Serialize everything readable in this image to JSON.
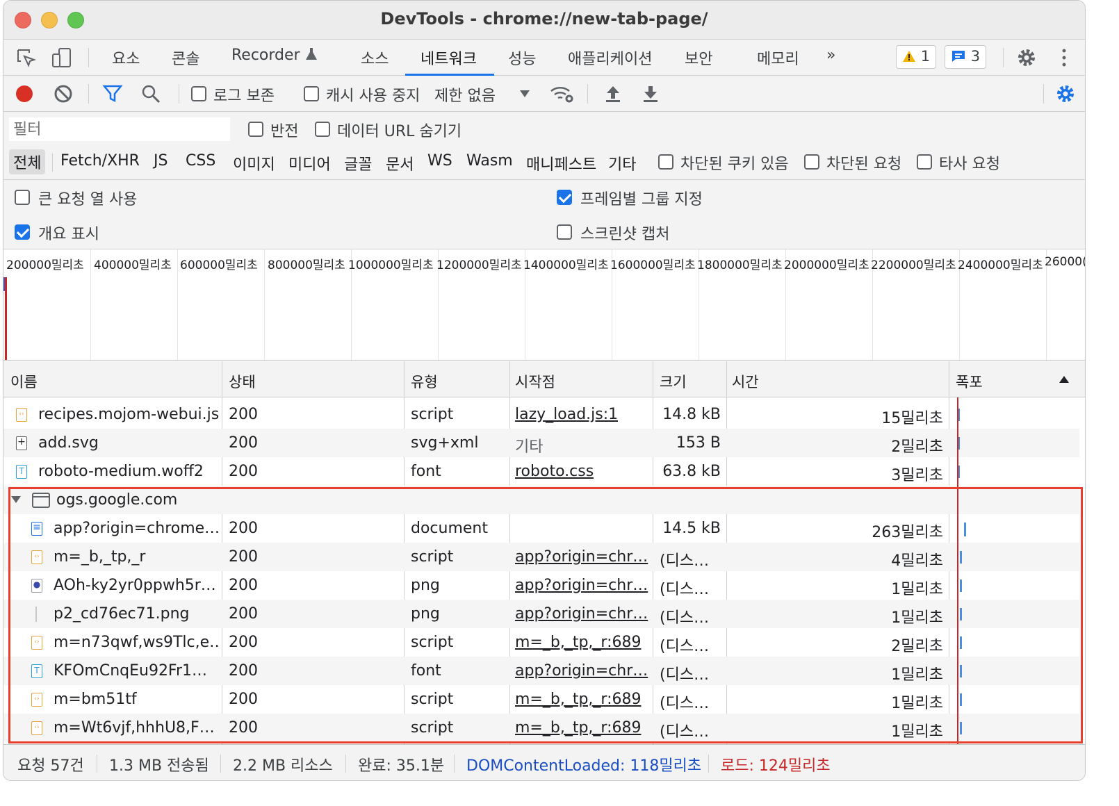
{
  "window": {
    "title": "DevTools - chrome://new-tab-page/"
  },
  "panel_tabs": [
    {
      "label": "요소"
    },
    {
      "label": "콘솔"
    },
    {
      "label": "Recorder"
    },
    {
      "label": "소스"
    },
    {
      "label": "네트워크",
      "active": true
    },
    {
      "label": "성능"
    },
    {
      "label": "애플리케이션"
    },
    {
      "label": "보안"
    },
    {
      "label": "메모리"
    }
  ],
  "panel_more": "»",
  "badges": {
    "warnings": "1",
    "messages": "3"
  },
  "toolbar": {
    "preserve_log": "로그 보존",
    "disable_cache": "캐시 사용 중지",
    "throttling": "제한 없음"
  },
  "filter": {
    "placeholder": "필터",
    "invert": "반전",
    "hide_data_urls": "데이터 URL 숨기기",
    "types": [
      "전체",
      "Fetch/XHR",
      "JS",
      "CSS",
      "이미지",
      "미디어",
      "글꼴",
      "문서",
      "WS",
      "Wasm",
      "매니페스트",
      "기타"
    ],
    "blocked_cookies": "차단된 쿠키 있음",
    "blocked_requests": "차단된 요청",
    "third_party": "타사 요청"
  },
  "settings": {
    "big_rows": "큰 요청 열 사용",
    "group_by_frame": "프레임별 그룹 지정",
    "show_overview": "개요 표시",
    "screenshots": "스크린샷 캡처"
  },
  "overview_ticks": [
    "200000밀리초",
    "400000밀리초",
    "600000밀리초",
    "800000밀리초",
    "1000000밀리초",
    "1200000밀리초",
    "1400000밀리초",
    "1600000밀리초",
    "1800000밀리초",
    "2000000밀리초",
    "2200000밀리초",
    "2400000밀리초",
    "26000("
  ],
  "columns": {
    "name": "이름",
    "status": "상태",
    "type": "유형",
    "initiator": "시작점",
    "size": "크기",
    "time": "시간",
    "waterfall": "폭포"
  },
  "rows": [
    {
      "name": "recipes.mojom-webui.js",
      "status": "200",
      "type": "script",
      "initiator": "lazy_load.js:1",
      "size": "14.8 kB",
      "time": "15밀리초"
    },
    {
      "name": "add.svg",
      "status": "200",
      "type": "svg+xml",
      "initiator": "기타",
      "size": "153 B",
      "time": "2밀리초"
    },
    {
      "name": "roboto-medium.woff2",
      "status": "200",
      "type": "font",
      "initiator": "roboto.css",
      "size": "63.8 kB",
      "time": "3밀리초"
    }
  ],
  "group": {
    "label": "ogs.google.com",
    "rows": [
      {
        "name": "app?origin=chrome…",
        "status": "200",
        "type": "document",
        "initiator": "",
        "size": "14.5 kB",
        "time": "263밀리초"
      },
      {
        "name": "m=_b,_tp,_r",
        "status": "200",
        "type": "script",
        "initiator": "app?origin=chr…",
        "size": "(디스…",
        "time": "4밀리초"
      },
      {
        "name": "AOh-ky2yr0ppwh5r…",
        "status": "200",
        "type": "png",
        "initiator": "app?origin=chr…",
        "size": "(디스…",
        "time": "1밀리초"
      },
      {
        "name": "p2_cd76ec71.png",
        "status": "200",
        "type": "png",
        "initiator": "app?origin=chr…",
        "size": "(디스…",
        "time": "1밀리초"
      },
      {
        "name": "m=n73qwf,ws9Tlc,e…",
        "status": "200",
        "type": "script",
        "initiator": "m=_b,_tp,_r:689",
        "size": "(디스…",
        "time": "2밀리초"
      },
      {
        "name": "KFOmCnqEu92Fr1…",
        "status": "200",
        "type": "font",
        "initiator": "app?origin=chr…",
        "size": "(디스…",
        "time": "1밀리초"
      },
      {
        "name": "m=bm51tf",
        "status": "200",
        "type": "script",
        "initiator": "m=_b,_tp,_r:689",
        "size": "(디스…",
        "time": "1밀리초"
      },
      {
        "name": "m=Wt6vjf,hhhU8,F…",
        "status": "200",
        "type": "script",
        "initiator": "m=_b,_tp,_r:689",
        "size": "(디스…",
        "time": "1밀리초"
      }
    ]
  },
  "status": {
    "requests": "요청 57건",
    "transferred": "1.3 MB 전송됨",
    "resources": "2.2 MB 리소스",
    "finish": "완료: 35.1분",
    "dcl": "DOMContentLoaded: 118밀리초",
    "load": "로드: 124밀리초"
  },
  "colors": {
    "accent": "#1a73e8",
    "highlight_box": "#e8402f",
    "dcl": "#1a4fc4",
    "load": "#c62828"
  }
}
